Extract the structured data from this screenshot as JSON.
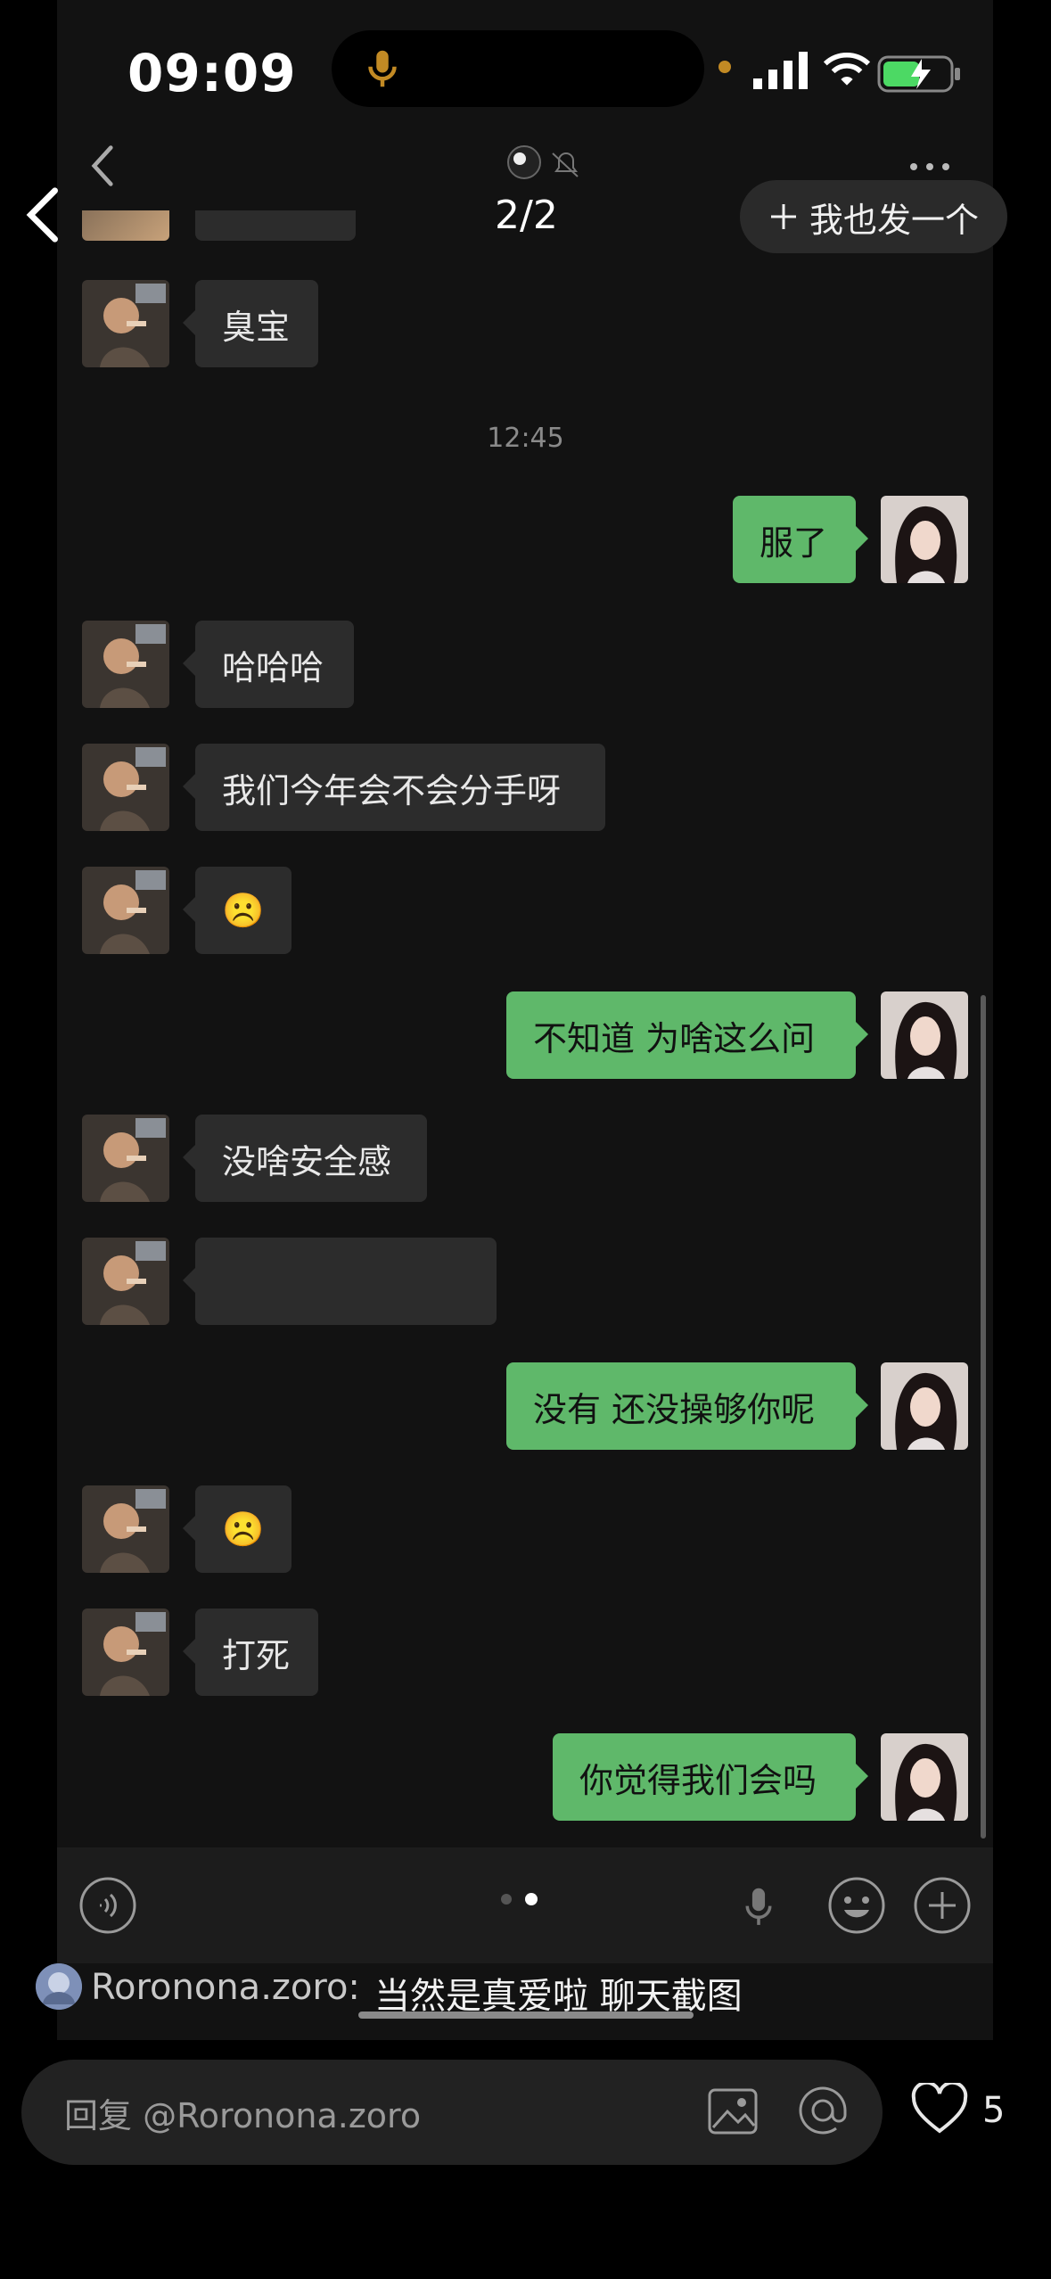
{
  "status": {
    "time": "09:09"
  },
  "header": {
    "pager": "2/2",
    "publish_button": "我也发一个"
  },
  "chat": {
    "timestamp": "12:45",
    "messages": [
      {
        "side": "in",
        "text": "臭宝"
      },
      {
        "side": "out",
        "text": "服了"
      },
      {
        "side": "in",
        "text": "哈哈哈"
      },
      {
        "side": "in",
        "text": "我们今年会不会分手呀"
      },
      {
        "side": "in",
        "text": "☹️"
      },
      {
        "side": "out",
        "text": "不知道 为啥这么问"
      },
      {
        "side": "in",
        "text": "没啥安全感"
      },
      {
        "side": "in",
        "text": "",
        "blurred": true
      },
      {
        "side": "out",
        "text": "没有 还没操够你呢"
      },
      {
        "side": "in",
        "text": "☹️"
      },
      {
        "side": "in",
        "text": "打死"
      },
      {
        "side": "out",
        "text": "你觉得我们会吗"
      }
    ]
  },
  "caption": {
    "author": "Roronona.zoro:",
    "text": "当然是真爱啦 聊天截图"
  },
  "reply": {
    "placeholder": "回复 @Roronona.zoro"
  },
  "likes": {
    "count": "5"
  },
  "colors": {
    "out_bubble": "#5fb86a",
    "in_bubble": "#2c2c2c",
    "background": "#121212"
  }
}
